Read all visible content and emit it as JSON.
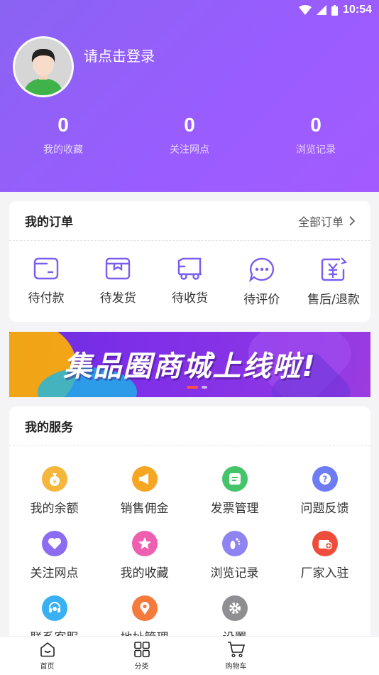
{
  "status_bar": {
    "time": "10:54"
  },
  "profile": {
    "login_prompt": "请点击登录"
  },
  "stats": [
    {
      "value": "0",
      "label": "我的收藏"
    },
    {
      "value": "0",
      "label": "关注网点"
    },
    {
      "value": "0",
      "label": "浏览记录"
    }
  ],
  "orders": {
    "title": "我的订单",
    "all_label": "全部订单",
    "items": [
      {
        "label": "待付款",
        "icon": "wallet-icon"
      },
      {
        "label": "待发货",
        "icon": "package-icon"
      },
      {
        "label": "待收货",
        "icon": "truck-icon"
      },
      {
        "label": "待评价",
        "icon": "comment-icon"
      },
      {
        "label": "售后/退款",
        "icon": "refund-icon"
      }
    ]
  },
  "banner": {
    "text": "集品圈商城上线啦!"
  },
  "services": {
    "title": "我的服务",
    "items": [
      {
        "label": "我的余额",
        "icon": "money-bag-icon",
        "color": "#f4b73c"
      },
      {
        "label": "销售佣金",
        "icon": "megaphone-icon",
        "color": "#f6a623"
      },
      {
        "label": "发票管理",
        "icon": "invoice-icon",
        "color": "#46c46a"
      },
      {
        "label": "问题反馈",
        "icon": "question-icon",
        "color": "#6d7cf2"
      },
      {
        "label": "关注网点",
        "icon": "heart-icon",
        "color": "#8c6df2"
      },
      {
        "label": "我的收藏",
        "icon": "star-icon",
        "color": "#ef5fb0"
      },
      {
        "label": "浏览记录",
        "icon": "footprint-icon",
        "color": "#8d84f2"
      },
      {
        "label": "厂家入驻",
        "icon": "factory-icon",
        "color": "#ee4d3c"
      },
      {
        "label": "联系客服",
        "icon": "headset-icon",
        "color": "#3ab0f4"
      },
      {
        "label": "地址管理",
        "icon": "location-icon",
        "color": "#f47a3d"
      },
      {
        "label": "设置",
        "icon": "gear-icon",
        "color": "#8e8e93"
      }
    ]
  },
  "tabbar": [
    {
      "label": "首页",
      "icon": "home-icon"
    },
    {
      "label": "分类",
      "icon": "category-icon"
    },
    {
      "label": "购物车",
      "icon": "cart-icon"
    }
  ]
}
